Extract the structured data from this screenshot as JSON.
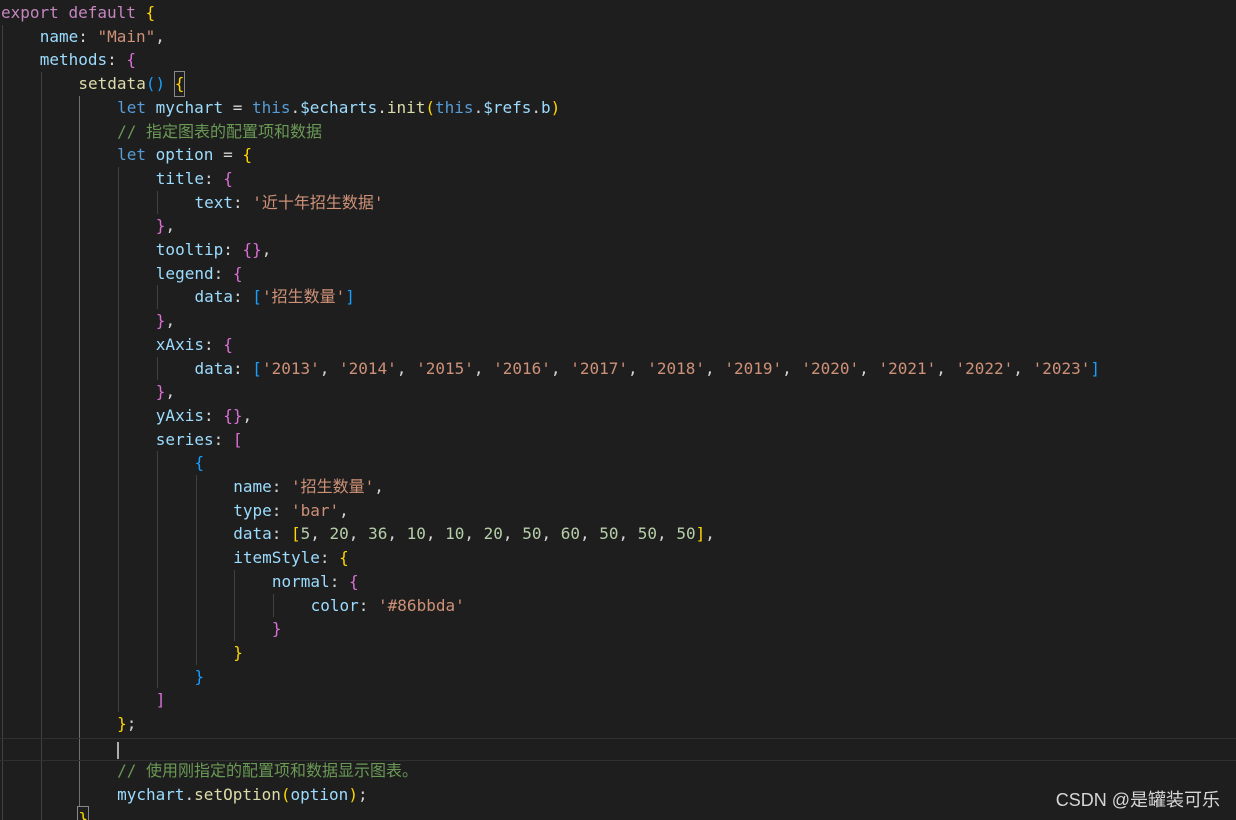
{
  "editor": {
    "background": "#1e1e1e",
    "token_colors": {
      "keyword": "#569cd6",
      "control": "#c586c0",
      "variable": "#9cdcfe",
      "function": "#dcdcaa",
      "string": "#ce9178",
      "number": "#b5cea8",
      "comment": "#6a9955",
      "bracket_level_1": "#ffd700",
      "bracket_level_2": "#da70d6",
      "bracket_level_3": "#179fff"
    },
    "lines": [
      {
        "indent": 0,
        "tokens": [
          [
            "ctrl",
            "export"
          ],
          [
            "p",
            " "
          ],
          [
            "ctrl",
            "default"
          ],
          [
            "p",
            " "
          ],
          [
            "b1",
            "{"
          ]
        ]
      },
      {
        "indent": 1,
        "tokens": [
          [
            "var",
            "name"
          ],
          [
            "p",
            ": "
          ],
          [
            "str",
            "\"Main\""
          ],
          [
            "p",
            ","
          ]
        ]
      },
      {
        "indent": 1,
        "tokens": [
          [
            "var",
            "methods"
          ],
          [
            "p",
            ": "
          ],
          [
            "b2",
            "{"
          ]
        ]
      },
      {
        "indent": 2,
        "tokens": [
          [
            "fn",
            "setdata"
          ],
          [
            "b3",
            "()"
          ],
          [
            "p",
            " "
          ],
          [
            "bm",
            "{"
          ]
        ]
      },
      {
        "indent": 3,
        "tokens": [
          [
            "kw",
            "let"
          ],
          [
            "p",
            " "
          ],
          [
            "var",
            "mychart"
          ],
          [
            "p",
            " = "
          ],
          [
            "kw",
            "this"
          ],
          [
            "p",
            "."
          ],
          [
            "var",
            "$echarts"
          ],
          [
            "p",
            "."
          ],
          [
            "fn",
            "init"
          ],
          [
            "b1",
            "("
          ],
          [
            "kw",
            "this"
          ],
          [
            "p",
            "."
          ],
          [
            "var",
            "$refs"
          ],
          [
            "p",
            "."
          ],
          [
            "var",
            "b"
          ],
          [
            "b1",
            ")"
          ]
        ]
      },
      {
        "indent": 3,
        "tokens": [
          [
            "cmt",
            "// 指定图表的配置项和数据"
          ]
        ]
      },
      {
        "indent": 3,
        "tokens": [
          [
            "kw",
            "let"
          ],
          [
            "p",
            " "
          ],
          [
            "var",
            "option"
          ],
          [
            "p",
            " = "
          ],
          [
            "b1",
            "{"
          ]
        ]
      },
      {
        "indent": 4,
        "tokens": [
          [
            "var",
            "title"
          ],
          [
            "p",
            ": "
          ],
          [
            "b2",
            "{"
          ]
        ]
      },
      {
        "indent": 5,
        "tokens": [
          [
            "var",
            "text"
          ],
          [
            "p",
            ": "
          ],
          [
            "str",
            "'近十年招生数据'"
          ]
        ]
      },
      {
        "indent": 4,
        "tokens": [
          [
            "b2",
            "}"
          ],
          [
            "p",
            ","
          ]
        ]
      },
      {
        "indent": 4,
        "tokens": [
          [
            "var",
            "tooltip"
          ],
          [
            "p",
            ": "
          ],
          [
            "b2",
            "{}"
          ],
          [
            "p",
            ","
          ]
        ]
      },
      {
        "indent": 4,
        "tokens": [
          [
            "var",
            "legend"
          ],
          [
            "p",
            ": "
          ],
          [
            "b2",
            "{"
          ]
        ]
      },
      {
        "indent": 5,
        "tokens": [
          [
            "var",
            "data"
          ],
          [
            "p",
            ": "
          ],
          [
            "b3",
            "["
          ],
          [
            "str",
            "'招生数量'"
          ],
          [
            "b3",
            "]"
          ]
        ]
      },
      {
        "indent": 4,
        "tokens": [
          [
            "b2",
            "}"
          ],
          [
            "p",
            ","
          ]
        ]
      },
      {
        "indent": 4,
        "tokens": [
          [
            "var",
            "xAxis"
          ],
          [
            "p",
            ": "
          ],
          [
            "b2",
            "{"
          ]
        ]
      },
      {
        "indent": 5,
        "tokens": [
          [
            "var",
            "data"
          ],
          [
            "p",
            ": "
          ],
          [
            "b3",
            "["
          ],
          [
            "str",
            "'2013'"
          ],
          [
            "p",
            ", "
          ],
          [
            "str",
            "'2014'"
          ],
          [
            "p",
            ", "
          ],
          [
            "str",
            "'2015'"
          ],
          [
            "p",
            ", "
          ],
          [
            "str",
            "'2016'"
          ],
          [
            "p",
            ", "
          ],
          [
            "str",
            "'2017'"
          ],
          [
            "p",
            ", "
          ],
          [
            "str",
            "'2018'"
          ],
          [
            "p",
            ", "
          ],
          [
            "str",
            "'2019'"
          ],
          [
            "p",
            ", "
          ],
          [
            "str",
            "'2020'"
          ],
          [
            "p",
            ", "
          ],
          [
            "str",
            "'2021'"
          ],
          [
            "p",
            ", "
          ],
          [
            "str",
            "'2022'"
          ],
          [
            "p",
            ", "
          ],
          [
            "str",
            "'2023'"
          ],
          [
            "b3",
            "]"
          ]
        ]
      },
      {
        "indent": 4,
        "tokens": [
          [
            "b2",
            "}"
          ],
          [
            "p",
            ","
          ]
        ]
      },
      {
        "indent": 4,
        "tokens": [
          [
            "var",
            "yAxis"
          ],
          [
            "p",
            ": "
          ],
          [
            "b2",
            "{}"
          ],
          [
            "p",
            ","
          ]
        ]
      },
      {
        "indent": 4,
        "tokens": [
          [
            "var",
            "series"
          ],
          [
            "p",
            ": "
          ],
          [
            "b2",
            "["
          ]
        ]
      },
      {
        "indent": 5,
        "tokens": [
          [
            "b3",
            "{"
          ]
        ]
      },
      {
        "indent": 6,
        "tokens": [
          [
            "var",
            "name"
          ],
          [
            "p",
            ": "
          ],
          [
            "str",
            "'招生数量'"
          ],
          [
            "p",
            ","
          ]
        ]
      },
      {
        "indent": 6,
        "tokens": [
          [
            "var",
            "type"
          ],
          [
            "p",
            ": "
          ],
          [
            "str",
            "'bar'"
          ],
          [
            "p",
            ","
          ]
        ]
      },
      {
        "indent": 6,
        "tokens": [
          [
            "var",
            "data"
          ],
          [
            "p",
            ": "
          ],
          [
            "b1",
            "["
          ],
          [
            "num",
            "5"
          ],
          [
            "p",
            ", "
          ],
          [
            "num",
            "20"
          ],
          [
            "p",
            ", "
          ],
          [
            "num",
            "36"
          ],
          [
            "p",
            ", "
          ],
          [
            "num",
            "10"
          ],
          [
            "p",
            ", "
          ],
          [
            "num",
            "10"
          ],
          [
            "p",
            ", "
          ],
          [
            "num",
            "20"
          ],
          [
            "p",
            ", "
          ],
          [
            "num",
            "50"
          ],
          [
            "p",
            ", "
          ],
          [
            "num",
            "60"
          ],
          [
            "p",
            ", "
          ],
          [
            "num",
            "50"
          ],
          [
            "p",
            ", "
          ],
          [
            "num",
            "50"
          ],
          [
            "p",
            ", "
          ],
          [
            "num",
            "50"
          ],
          [
            "b1",
            "]"
          ],
          [
            "p",
            ","
          ]
        ]
      },
      {
        "indent": 6,
        "tokens": [
          [
            "var",
            "itemStyle"
          ],
          [
            "p",
            ": "
          ],
          [
            "b1",
            "{"
          ]
        ]
      },
      {
        "indent": 7,
        "tokens": [
          [
            "var",
            "normal"
          ],
          [
            "p",
            ": "
          ],
          [
            "b2",
            "{"
          ]
        ]
      },
      {
        "indent": 8,
        "tokens": [
          [
            "var",
            "color"
          ],
          [
            "p",
            ": "
          ],
          [
            "str",
            "'#86bbda'"
          ]
        ]
      },
      {
        "indent": 7,
        "tokens": [
          [
            "b2",
            "}"
          ]
        ]
      },
      {
        "indent": 6,
        "tokens": [
          [
            "b1",
            "}"
          ]
        ]
      },
      {
        "indent": 5,
        "tokens": [
          [
            "b3",
            "}"
          ]
        ]
      },
      {
        "indent": 4,
        "tokens": [
          [
            "b2",
            "]"
          ]
        ]
      },
      {
        "indent": 3,
        "tokens": [
          [
            "b1",
            "}"
          ],
          [
            "p",
            ";"
          ]
        ]
      },
      {
        "indent": 0,
        "tokens": []
      },
      {
        "indent": 3,
        "tokens": [
          [
            "cmt",
            "// 使用刚指定的配置项和数据显示图表。"
          ]
        ]
      },
      {
        "indent": 3,
        "tokens": [
          [
            "var",
            "mychart"
          ],
          [
            "p",
            "."
          ],
          [
            "fn",
            "setOption"
          ],
          [
            "b1",
            "("
          ],
          [
            "var",
            "option"
          ],
          [
            "b1",
            ")"
          ],
          [
            "p",
            ";"
          ]
        ]
      },
      {
        "indent": 2,
        "tokens": [
          [
            "bm",
            "}"
          ]
        ]
      }
    ]
  },
  "watermark": "CSDN @是罐装可乐"
}
